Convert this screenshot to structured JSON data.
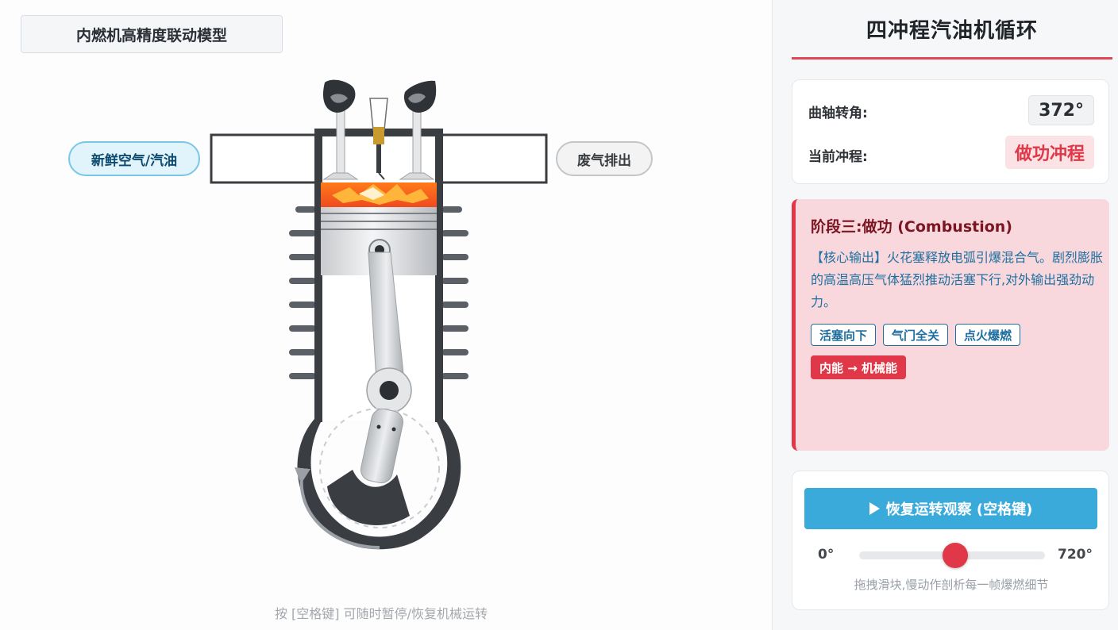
{
  "model": {
    "title": "内燃机高精度联动模型",
    "intake_label": "新鲜空气/汽油",
    "exhaust_label": "废气排出",
    "hint": "按 [空格键] 可随时暂停/恢复机械运转"
  },
  "panel": {
    "title": "四冲程汽油机循环",
    "angle_label": "曲轴转角:",
    "angle_value": "372°",
    "stroke_label": "当前冲程:",
    "stroke_value": "做功冲程"
  },
  "phase": {
    "title": "阶段三:做功 (Combustion)",
    "description": "【核心输出】火花塞释放电弧引爆混合气。剧烈膨胀的高温高压气体猛烈推动活塞下行,对外输出强劲动力。",
    "tags": [
      "活塞向下",
      "气门全关",
      "点火爆燃"
    ],
    "energy": "内能 → 机械能"
  },
  "controls": {
    "resume_label": "恢复运转观察 (空格键)",
    "slider_min": "0°",
    "slider_max": "720°",
    "slider_value_fraction": 0.517,
    "slider_help": "拖拽滑块,慢动作剖析每一帧爆燃细节"
  },
  "colors": {
    "accent_red": "#e03848",
    "button_blue": "#3aaadb",
    "phase_bg": "#f8d8dc",
    "phase_text": "#1e6fa0"
  }
}
